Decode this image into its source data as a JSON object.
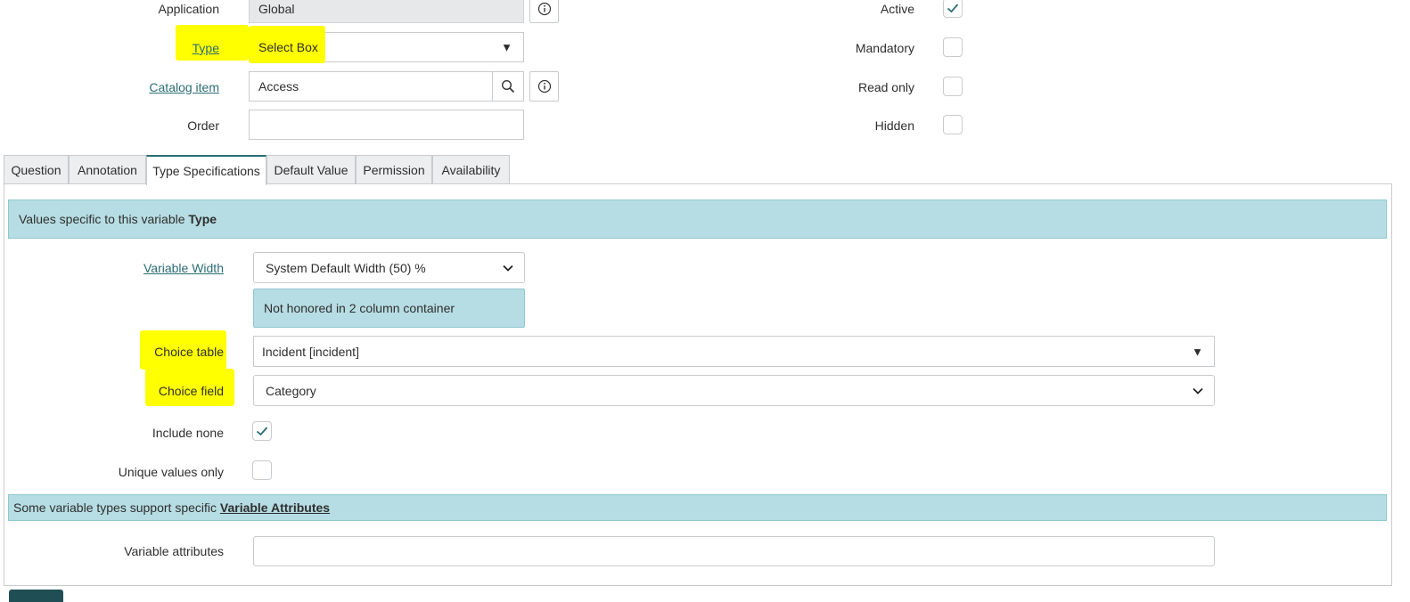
{
  "top_form": {
    "application": {
      "label": "Application",
      "value": "Global"
    },
    "type": {
      "label": "Type",
      "value": "Select Box"
    },
    "catalog_item": {
      "label": "Catalog item",
      "value": "Access"
    },
    "order": {
      "label": "Order",
      "value": ""
    },
    "active": {
      "label": "Active",
      "checked": true
    },
    "mandatory": {
      "label": "Mandatory",
      "checked": false
    },
    "read_only": {
      "label": "Read only",
      "checked": false
    },
    "hidden": {
      "label": "Hidden",
      "checked": false
    }
  },
  "tabs": [
    {
      "label": "Question",
      "active": false
    },
    {
      "label": "Annotation",
      "active": false
    },
    {
      "label": "Type Specifications",
      "active": true
    },
    {
      "label": "Default Value",
      "active": false
    },
    {
      "label": "Permission",
      "active": false
    },
    {
      "label": "Availability",
      "active": false
    }
  ],
  "type_spec": {
    "banner_text": "Values specific to this variable ",
    "banner_bold": "Type",
    "variable_width": {
      "label": "Variable Width",
      "value": "System Default Width (50) %"
    },
    "width_note": "Not honored in 2 column container",
    "choice_table": {
      "label": "Choice table",
      "value": "Incident [incident]"
    },
    "choice_field": {
      "label": "Choice field",
      "value": "Category"
    },
    "include_none": {
      "label": "Include none",
      "checked": true
    },
    "unique_values": {
      "label": "Unique values only",
      "checked": false
    },
    "attr_banner_text": "Some variable types support specific ",
    "attr_banner_link": "Variable Attributes",
    "variable_attributes": {
      "label": "Variable attributes",
      "value": ""
    }
  },
  "colors": {
    "accent": "#2b6d74",
    "banner": "#b6dde3",
    "highlight": "#ffff00"
  },
  "icons": {
    "info": "info-icon",
    "search": "search-icon",
    "dropdown": "caret-down-icon",
    "check": "check-icon"
  }
}
